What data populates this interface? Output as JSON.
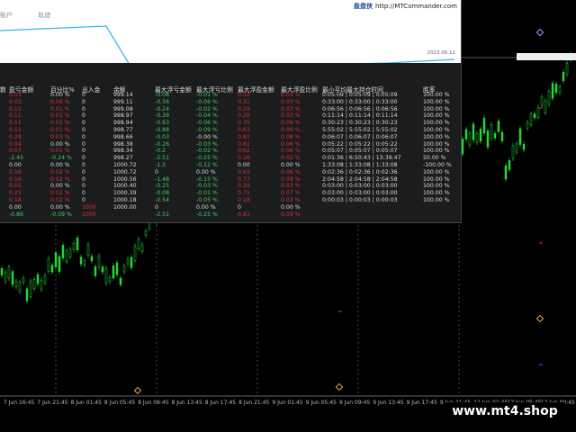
{
  "panel": {
    "tabs": [
      "账户",
      "轨迹"
    ],
    "brand_name": "盈盘侠",
    "brand_url": "http://MTCommander.com",
    "timestamp": "2023.06.12"
  },
  "table": {
    "headers": [
      "数",
      "盈亏金额",
      "百分比%",
      "出入金",
      "余额",
      "最大浮亏金额",
      "最大浮亏比例",
      "最大浮盈金额",
      "最大浮盈比例",
      "最小平均最大持仓时间",
      "胜率"
    ],
    "rows": [
      [
        "",
        "0.03",
        "0.00 %",
        "0",
        "999.14",
        "-0.08",
        "-0.01 %",
        "0.32",
        "0.03 %",
        "0:05:09 | 0:05:09 | 0:05:09",
        "100.00 %"
      ],
      [
        "",
        "0.03",
        "0.06 %",
        "0",
        "999.11",
        "-0.56",
        "-0.06 %",
        "0.31",
        "0.03 %",
        "0:33:00 | 0:33:00 | 0:33:00",
        "100.00 %"
      ],
      [
        "",
        "0.11",
        "0.01 %",
        "0",
        "999.08",
        "-0.24",
        "-0.02 %",
        "0.29",
        "0.03 %",
        "0:06:56 | 0:06:56 | 0:06:56",
        "100.00 %"
      ],
      [
        "",
        "0.11",
        "0.01 %",
        "0",
        "998.97",
        "-0.39",
        "-0.04 %",
        "0.29",
        "0.03 %",
        "0:11:14 | 0:11:14 | 0:11:14",
        "100.00 %"
      ],
      [
        "",
        "0.11",
        "0.01 %",
        "0",
        "998.94",
        "-0.63",
        "-0.06 %",
        "0.75",
        "0.08 %",
        "0:30:23 | 0:30:23 | 0:30:23",
        "100.00 %"
      ],
      [
        "",
        "0.11",
        "0.01 %",
        "0",
        "998.77",
        "-0.88",
        "-0.09 %",
        "0.63",
        "0.06 %",
        "5:55:02 | 5:55:02 | 5:55:02",
        "100.00 %"
      ],
      [
        "",
        "0.28",
        "0.03 %",
        "0",
        "998.66",
        "-0.03",
        "-0.00 %",
        "0.81",
        "0.08 %",
        "0:06:07 | 0:06:07 | 0:06:07",
        "100.00 %"
      ],
      [
        "",
        "0.04",
        "0.00 %",
        "0",
        "998.38",
        "-0.26",
        "-0.03 %",
        "0.61",
        "0.06 %",
        "0:05:22 | 0:05:22 | 0:05:22",
        "100.00 %"
      ],
      [
        "",
        "0.07",
        "0.01 %",
        "0",
        "998.34",
        "-0.2",
        "-0.02 %",
        "0.62",
        "0.06 %",
        "0:05:07 | 0:05:07 | 0:05:07",
        "100.00 %"
      ],
      [
        "",
        "-2.45",
        "-0.24 %",
        "0",
        "998.27",
        "-2.51",
        "-0.25 %",
        "0.16",
        "0.02 %",
        "0:01:36 | 6:50:43 | 13:39:47",
        "50.00 %"
      ],
      [
        "",
        "0.00",
        "0.00 %",
        "0",
        "1000.72",
        "-1.2",
        "-0.12 %",
        "0.00",
        "0.00 %",
        "1:33:08 | 1:33:08 | 1:33:08",
        "-100.00 %"
      ],
      [
        "",
        "0.16",
        "0.02 %",
        "0",
        "1000.72",
        "0",
        "0.00 %",
        "0.63",
        "0.06 %",
        "0:02:36 | 0:02:36 | 0:02:36",
        "100.00 %"
      ],
      [
        "",
        "0.16",
        "0.02 %",
        "0",
        "1000.56",
        "-1.48",
        "-0.15 %",
        "0.77",
        "0.08 %",
        "2:04:58 | 2:04:58 | 2:04:58",
        "100.00 %"
      ],
      [
        "",
        "0.01",
        "0.00 %",
        "0",
        "1000.40",
        "-0.25",
        "-0.03 %",
        "0.29",
        "0.03 %",
        "0:03:00 | 0:03:00 | 0:03:00",
        "100.00 %"
      ],
      [
        "",
        "0.21",
        "0.02 %",
        "0",
        "1000.39",
        "-0.08",
        "-0.01 %",
        "0.71",
        "0.07 %",
        "0:03:00 | 0:03:00 | 0:03:00",
        "100.00 %"
      ],
      [
        "",
        "0.18",
        "0.02 %",
        "0",
        "1000.18",
        "-0.54",
        "-0.05 %",
        "0.28",
        "0.03 %",
        "0:00:03 | 0:00:03 | 0:00:03",
        "100.00 %"
      ],
      [
        "",
        "0.00",
        "0.00 %",
        "1000",
        "1000.00",
        "0",
        "0.00 %",
        "0",
        "0.00 %",
        "",
        ""
      ],
      [
        "",
        "-0.86",
        "-0.09 %",
        "1000",
        "",
        "-2.51",
        "-0.25 %",
        "0.81",
        "0.09 %",
        "",
        ""
      ]
    ]
  },
  "time_axis": [
    "7 Jun 16:45",
    "7 Jun 21:45",
    "8 Jun 01:45",
    "8 Jun 05:45",
    "8 Jun 09:45",
    "8 Jun 13:45",
    "8 Jun 17:45",
    "8 Jun 21:45",
    "9 Jun 01:45",
    "9 Jun 05:45",
    "9 Jun 09:45",
    "9 Jun 13:45",
    "9 Jun 17:45",
    "9 Jun 21:45",
    "12 Jun 01:45",
    "12 Jun 05:45",
    "12 Jun 09:45"
  ],
  "watermark": "www.mt4.shop",
  "colors": {
    "positive": "#3fd25a",
    "negative": "#d9303a",
    "neutral": "#dddddd",
    "curve": "#38b6e8",
    "candle": "#27d63a"
  }
}
